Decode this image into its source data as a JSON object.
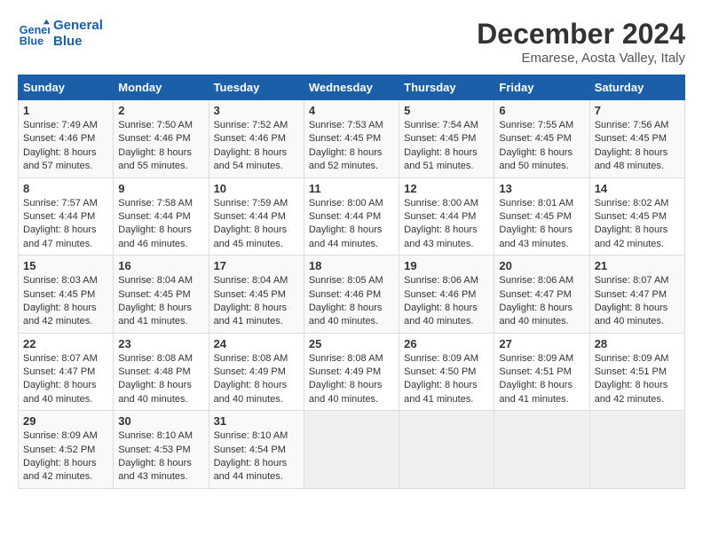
{
  "header": {
    "logo_line1": "General",
    "logo_line2": "Blue",
    "month": "December 2024",
    "location": "Emarese, Aosta Valley, Italy"
  },
  "weekdays": [
    "Sunday",
    "Monday",
    "Tuesday",
    "Wednesday",
    "Thursday",
    "Friday",
    "Saturday"
  ],
  "weeks": [
    [
      {
        "day": "1",
        "sunrise": "7:49 AM",
        "sunset": "4:46 PM",
        "daylight": "8 hours and 57 minutes."
      },
      {
        "day": "2",
        "sunrise": "7:50 AM",
        "sunset": "4:46 PM",
        "daylight": "8 hours and 55 minutes."
      },
      {
        "day": "3",
        "sunrise": "7:52 AM",
        "sunset": "4:46 PM",
        "daylight": "8 hours and 54 minutes."
      },
      {
        "day": "4",
        "sunrise": "7:53 AM",
        "sunset": "4:45 PM",
        "daylight": "8 hours and 52 minutes."
      },
      {
        "day": "5",
        "sunrise": "7:54 AM",
        "sunset": "4:45 PM",
        "daylight": "8 hours and 51 minutes."
      },
      {
        "day": "6",
        "sunrise": "7:55 AM",
        "sunset": "4:45 PM",
        "daylight": "8 hours and 50 minutes."
      },
      {
        "day": "7",
        "sunrise": "7:56 AM",
        "sunset": "4:45 PM",
        "daylight": "8 hours and 48 minutes."
      }
    ],
    [
      {
        "day": "8",
        "sunrise": "7:57 AM",
        "sunset": "4:44 PM",
        "daylight": "8 hours and 47 minutes."
      },
      {
        "day": "9",
        "sunrise": "7:58 AM",
        "sunset": "4:44 PM",
        "daylight": "8 hours and 46 minutes."
      },
      {
        "day": "10",
        "sunrise": "7:59 AM",
        "sunset": "4:44 PM",
        "daylight": "8 hours and 45 minutes."
      },
      {
        "day": "11",
        "sunrise": "8:00 AM",
        "sunset": "4:44 PM",
        "daylight": "8 hours and 44 minutes."
      },
      {
        "day": "12",
        "sunrise": "8:00 AM",
        "sunset": "4:44 PM",
        "daylight": "8 hours and 43 minutes."
      },
      {
        "day": "13",
        "sunrise": "8:01 AM",
        "sunset": "4:45 PM",
        "daylight": "8 hours and 43 minutes."
      },
      {
        "day": "14",
        "sunrise": "8:02 AM",
        "sunset": "4:45 PM",
        "daylight": "8 hours and 42 minutes."
      }
    ],
    [
      {
        "day": "15",
        "sunrise": "8:03 AM",
        "sunset": "4:45 PM",
        "daylight": "8 hours and 42 minutes."
      },
      {
        "day": "16",
        "sunrise": "8:04 AM",
        "sunset": "4:45 PM",
        "daylight": "8 hours and 41 minutes."
      },
      {
        "day": "17",
        "sunrise": "8:04 AM",
        "sunset": "4:45 PM",
        "daylight": "8 hours and 41 minutes."
      },
      {
        "day": "18",
        "sunrise": "8:05 AM",
        "sunset": "4:46 PM",
        "daylight": "8 hours and 40 minutes."
      },
      {
        "day": "19",
        "sunrise": "8:06 AM",
        "sunset": "4:46 PM",
        "daylight": "8 hours and 40 minutes."
      },
      {
        "day": "20",
        "sunrise": "8:06 AM",
        "sunset": "4:47 PM",
        "daylight": "8 hours and 40 minutes."
      },
      {
        "day": "21",
        "sunrise": "8:07 AM",
        "sunset": "4:47 PM",
        "daylight": "8 hours and 40 minutes."
      }
    ],
    [
      {
        "day": "22",
        "sunrise": "8:07 AM",
        "sunset": "4:47 PM",
        "daylight": "8 hours and 40 minutes."
      },
      {
        "day": "23",
        "sunrise": "8:08 AM",
        "sunset": "4:48 PM",
        "daylight": "8 hours and 40 minutes."
      },
      {
        "day": "24",
        "sunrise": "8:08 AM",
        "sunset": "4:49 PM",
        "daylight": "8 hours and 40 minutes."
      },
      {
        "day": "25",
        "sunrise": "8:08 AM",
        "sunset": "4:49 PM",
        "daylight": "8 hours and 40 minutes."
      },
      {
        "day": "26",
        "sunrise": "8:09 AM",
        "sunset": "4:50 PM",
        "daylight": "8 hours and 41 minutes."
      },
      {
        "day": "27",
        "sunrise": "8:09 AM",
        "sunset": "4:51 PM",
        "daylight": "8 hours and 41 minutes."
      },
      {
        "day": "28",
        "sunrise": "8:09 AM",
        "sunset": "4:51 PM",
        "daylight": "8 hours and 42 minutes."
      }
    ],
    [
      {
        "day": "29",
        "sunrise": "8:09 AM",
        "sunset": "4:52 PM",
        "daylight": "8 hours and 42 minutes."
      },
      {
        "day": "30",
        "sunrise": "8:10 AM",
        "sunset": "4:53 PM",
        "daylight": "8 hours and 43 minutes."
      },
      {
        "day": "31",
        "sunrise": "8:10 AM",
        "sunset": "4:54 PM",
        "daylight": "8 hours and 44 minutes."
      },
      null,
      null,
      null,
      null
    ]
  ]
}
